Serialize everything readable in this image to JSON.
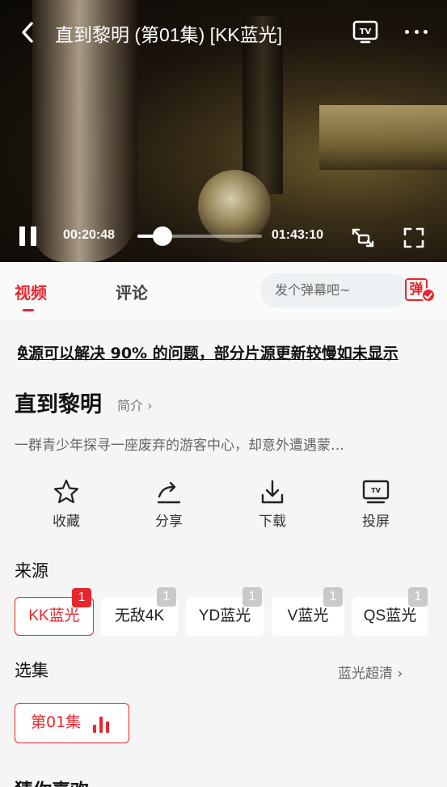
{
  "player": {
    "title": "直到黎明 (第01集) [KK蓝光]",
    "current_time": "00:20:48",
    "total_time": "01:43:10",
    "progress_fraction": 0.2,
    "icons": [
      "back-icon",
      "tv-cast-icon",
      "more-icon",
      "pause-icon",
      "rotate-icon",
      "fullscreen-icon"
    ]
  },
  "tabs": {
    "video": "视频",
    "comment": "评论"
  },
  "danmaku": {
    "placeholder": "发个弹幕吧~",
    "toggle_label": "弹"
  },
  "notice": "换源可以解决 90% 的问题，部分片源更新较慢如未显示",
  "show": {
    "title": "直到黎明",
    "intro_label": "简介 ›",
    "description": "一群青少年探寻一座废弃的游客中心，却意外遭遇蒙…"
  },
  "actions": [
    {
      "label": "收藏",
      "icon": "star-icon"
    },
    {
      "label": "分享",
      "icon": "share-icon"
    },
    {
      "label": "下载",
      "icon": "download-icon"
    },
    {
      "label": "投屏",
      "icon": "tv-icon"
    }
  ],
  "source": {
    "title": "来源",
    "chips": [
      {
        "label": "KK蓝光",
        "badge": "1",
        "active": true
      },
      {
        "label": "无敌4K",
        "badge": "1"
      },
      {
        "label": "YD蓝光",
        "badge": "1"
      },
      {
        "label": "V蓝光",
        "badge": "1"
      },
      {
        "label": "QS蓝光",
        "badge": "1"
      }
    ]
  },
  "episodes": {
    "title": "选集",
    "quality_label": "蓝光超清 ›",
    "items": [
      {
        "label": "第01集"
      }
    ]
  },
  "recommend": {
    "title": "猜你喜欢"
  },
  "colors": {
    "accent": "#e8262d",
    "page_bg": "#f5f5f5"
  }
}
